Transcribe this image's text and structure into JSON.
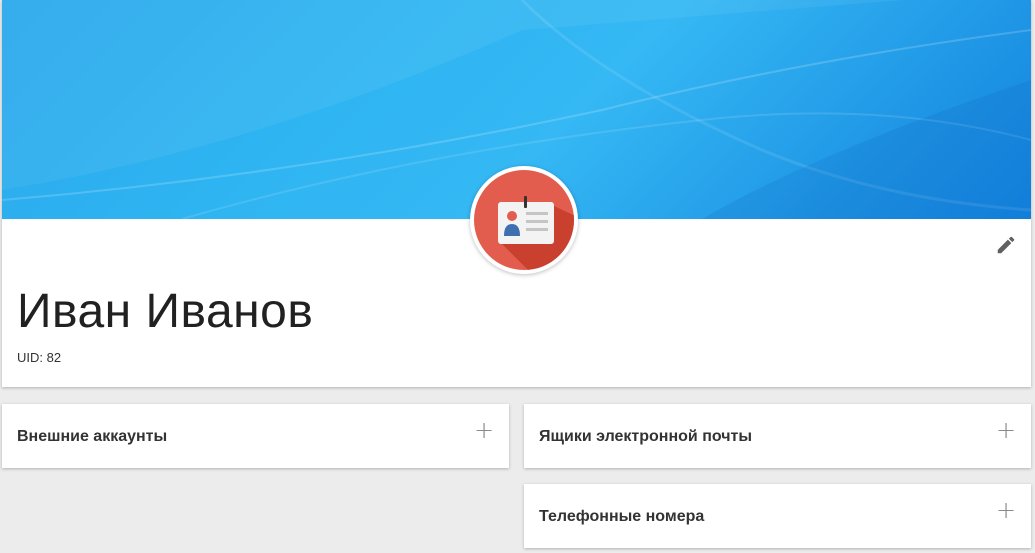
{
  "profile": {
    "name": "Иван Иванов",
    "uid_label": "UID: 82",
    "avatar_icon": "id-card-icon",
    "edit_icon": "pencil-icon"
  },
  "colors": {
    "cover": "#2fb5f2",
    "avatar_bg": "#e25d4d",
    "page_bg": "#ececec"
  },
  "panels": {
    "external_accounts": {
      "title": "Внешние аккаунты",
      "add_icon": "plus-icon",
      "add_label": "+"
    },
    "mailboxes": {
      "title": "Ящики электронной почты",
      "add_icon": "plus-icon",
      "add_label": "+"
    },
    "phone_numbers": {
      "title": "Телефонные номера",
      "add_icon": "plus-icon",
      "add_label": "+"
    }
  }
}
